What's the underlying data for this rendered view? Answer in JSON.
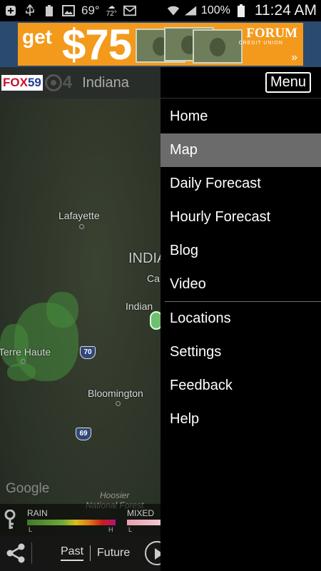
{
  "status_bar": {
    "weather_temp": "69°",
    "forecast_temp": "72°",
    "battery_percent": "100%",
    "time": "11:24 AM",
    "icons": [
      "plus-box-icon",
      "usb-icon",
      "battery-small-icon",
      "image-icon",
      "partly-cloudy-icon",
      "mail-icon",
      "wifi-icon",
      "signal-icon",
      "battery-icon"
    ]
  },
  "ad": {
    "get_text": "get",
    "amount": "$75",
    "brand": "FORUM",
    "brand_sub": "CREDIT UNION",
    "arrow": "»",
    "accent": "#f39a1c"
  },
  "app": {
    "logo_fox": "FOX",
    "logo_fox_num": "59",
    "logo_cbs_num": "4",
    "title": "Indiana"
  },
  "map": {
    "labels": {
      "lafayette": "Lafayette",
      "state": "INDIA",
      "ca": "Ca",
      "indian": "Indian",
      "terre_haute": "Terre Haute",
      "bloomington": "Bloomington"
    },
    "shields": {
      "i70": "70",
      "i69": "69"
    },
    "google": "Google",
    "watermark_line1": "Hoosier",
    "watermark_line2": "National Forest",
    "legend": {
      "rain": "RAIN",
      "mixed": "MIXED",
      "low": "L",
      "high": "H",
      "rain_colors": [
        "#3f7a2a",
        "#6fa83a",
        "#d9c020",
        "#e07a18",
        "#c81d1d",
        "#b0157a"
      ],
      "mixed_colors": [
        "#e8a0b0",
        "#f0c8d0"
      ]
    },
    "controls": {
      "past": "Past",
      "future": "Future"
    }
  },
  "menu": {
    "button_label": "Menu",
    "items_group1": [
      {
        "label": "Home",
        "active": false
      },
      {
        "label": "Map",
        "active": true
      },
      {
        "label": "Daily Forecast",
        "active": false
      },
      {
        "label": "Hourly Forecast",
        "active": false
      },
      {
        "label": "Blog",
        "active": false
      },
      {
        "label": "Video",
        "active": false
      }
    ],
    "items_group2": [
      {
        "label": "Locations",
        "active": false
      },
      {
        "label": "Settings",
        "active": false
      },
      {
        "label": "Feedback",
        "active": false
      },
      {
        "label": "Help",
        "active": false
      }
    ]
  }
}
